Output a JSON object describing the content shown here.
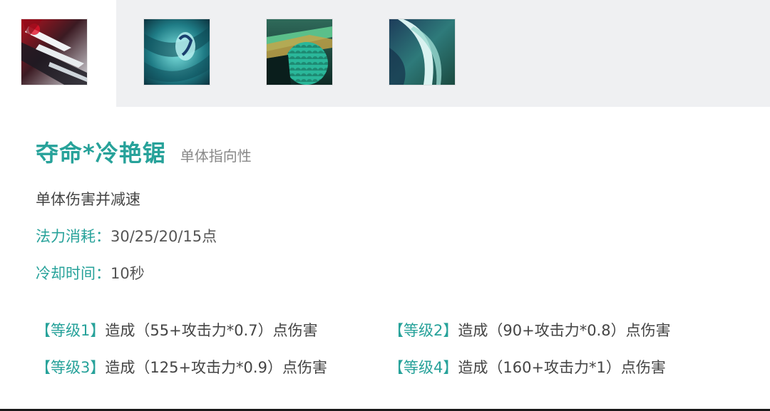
{
  "tabs": [
    {
      "icon": "blade-slash-icon",
      "active": true
    },
    {
      "icon": "hand-grip-icon",
      "active": false
    },
    {
      "icon": "scaled-armor-icon",
      "active": false
    },
    {
      "icon": "wind-blade-icon",
      "active": false
    }
  ],
  "skill": {
    "name": "夺命*冷艳锯",
    "type": "单体指向性",
    "description": "单体伤害并减速",
    "mana_label": "法力消耗：",
    "mana_value": "30/25/20/15点",
    "cooldown_label": "冷却时间：",
    "cooldown_value": "10秒",
    "levels": [
      {
        "tag": "【等级1】",
        "effect": "造成（55+攻击力*0.7）点伤害"
      },
      {
        "tag": "【等级2】",
        "effect": "造成（90+攻击力*0.8）点伤害"
      },
      {
        "tag": "【等级3】",
        "effect": "造成（125+攻击力*0.9）点伤害"
      },
      {
        "tag": "【等级4】",
        "effect": "造成（160+攻击力*1）点伤害"
      }
    ]
  },
  "colors": {
    "accent": "#27a29a",
    "tabbar_bg": "#eff0f2",
    "text": "#444444",
    "muted": "#888888"
  }
}
